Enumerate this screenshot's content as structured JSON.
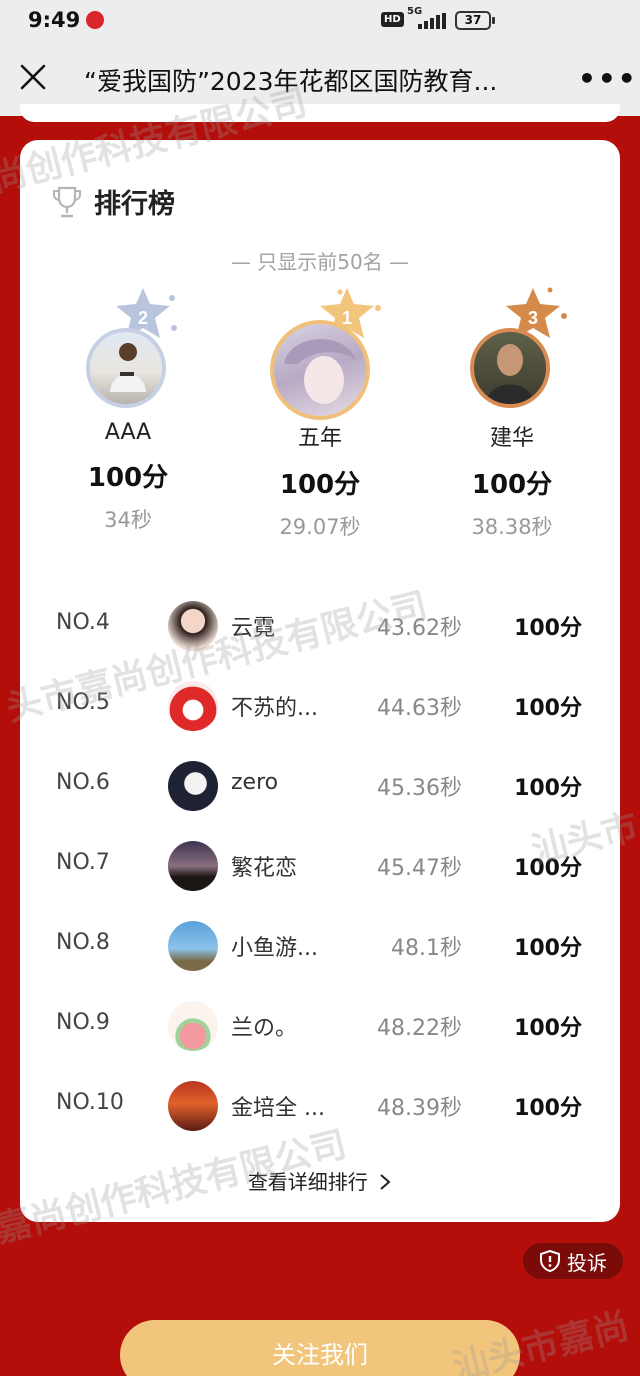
{
  "status_bar": {
    "time": "9:49",
    "network": "5G",
    "hd": "HD",
    "battery": "37"
  },
  "nav": {
    "title": "“爱我国防”2023年花都区国防教育...",
    "close_icon": "close-icon",
    "more_icon": "more-icon",
    "more_label": "•••"
  },
  "card": {
    "title": "排行榜",
    "subtitle": "— 只显示前50名 —",
    "podium": [
      {
        "rank": "2",
        "name": "AAA",
        "score": "100分",
        "time": "34秒"
      },
      {
        "rank": "1",
        "name": "五年",
        "score": "100分",
        "time": "29.07秒"
      },
      {
        "rank": "3",
        "name": "建华",
        "score": "100分",
        "time": "38.38秒"
      }
    ],
    "list": [
      {
        "no": "NO.4",
        "name": "云霓",
        "time": "43.62秒",
        "score": "100分"
      },
      {
        "no": "NO.5",
        "name": "不苏的...",
        "time": "44.63秒",
        "score": "100分"
      },
      {
        "no": "NO.6",
        "name": "zero",
        "time": "45.36秒",
        "score": "100分"
      },
      {
        "no": "NO.7",
        "name": "繁花恋",
        "time": "45.47秒",
        "score": "100分"
      },
      {
        "no": "NO.8",
        "name": "小鱼游...",
        "time": "48.1秒",
        "score": "100分"
      },
      {
        "no": "NO.9",
        "name": "兰の。",
        "time": "48.22秒",
        "score": "100分"
      },
      {
        "no": "NO.10",
        "name": "金培全 ...",
        "time": "48.39秒",
        "score": "100分"
      }
    ],
    "more_link": "查看详细排行"
  },
  "complain_label": "投诉",
  "follow_label": "关注我们",
  "watermarks": [
    "尚创作科技有限公司",
    "头市嘉尚创作科技有限公司",
    "汕头市",
    "嘉尚创作科技有限公司",
    "汕头市嘉尚"
  ],
  "colors": {
    "bg_red": "#b40e0b",
    "gold": "#f2c57c",
    "bronze": "#d68a4a",
    "silver": "#b9c4de"
  }
}
